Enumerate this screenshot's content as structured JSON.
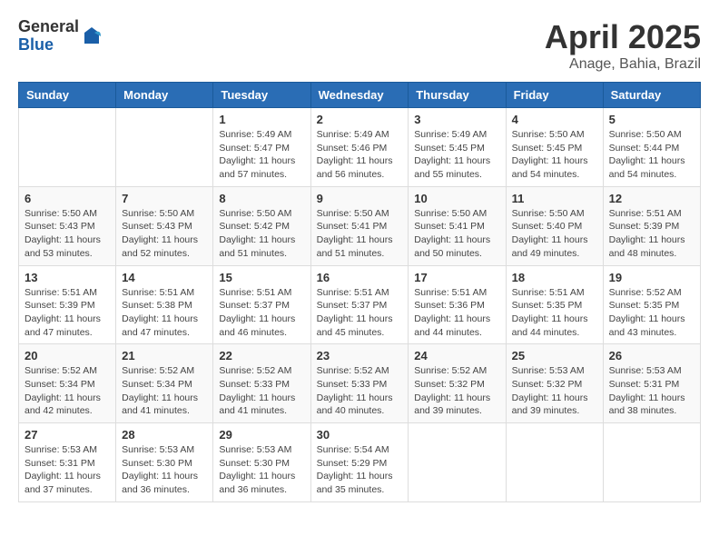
{
  "logo": {
    "general": "General",
    "blue": "Blue"
  },
  "title": "April 2025",
  "location": "Anage, Bahia, Brazil",
  "weekdays": [
    "Sunday",
    "Monday",
    "Tuesday",
    "Wednesday",
    "Thursday",
    "Friday",
    "Saturday"
  ],
  "weeks": [
    [
      {
        "day": "",
        "sunrise": "",
        "sunset": "",
        "daylight": ""
      },
      {
        "day": "",
        "sunrise": "",
        "sunset": "",
        "daylight": ""
      },
      {
        "day": "1",
        "sunrise": "Sunrise: 5:49 AM",
        "sunset": "Sunset: 5:47 PM",
        "daylight": "Daylight: 11 hours and 57 minutes."
      },
      {
        "day": "2",
        "sunrise": "Sunrise: 5:49 AM",
        "sunset": "Sunset: 5:46 PM",
        "daylight": "Daylight: 11 hours and 56 minutes."
      },
      {
        "day": "3",
        "sunrise": "Sunrise: 5:49 AM",
        "sunset": "Sunset: 5:45 PM",
        "daylight": "Daylight: 11 hours and 55 minutes."
      },
      {
        "day": "4",
        "sunrise": "Sunrise: 5:50 AM",
        "sunset": "Sunset: 5:45 PM",
        "daylight": "Daylight: 11 hours and 54 minutes."
      },
      {
        "day": "5",
        "sunrise": "Sunrise: 5:50 AM",
        "sunset": "Sunset: 5:44 PM",
        "daylight": "Daylight: 11 hours and 54 minutes."
      }
    ],
    [
      {
        "day": "6",
        "sunrise": "Sunrise: 5:50 AM",
        "sunset": "Sunset: 5:43 PM",
        "daylight": "Daylight: 11 hours and 53 minutes."
      },
      {
        "day": "7",
        "sunrise": "Sunrise: 5:50 AM",
        "sunset": "Sunset: 5:43 PM",
        "daylight": "Daylight: 11 hours and 52 minutes."
      },
      {
        "day": "8",
        "sunrise": "Sunrise: 5:50 AM",
        "sunset": "Sunset: 5:42 PM",
        "daylight": "Daylight: 11 hours and 51 minutes."
      },
      {
        "day": "9",
        "sunrise": "Sunrise: 5:50 AM",
        "sunset": "Sunset: 5:41 PM",
        "daylight": "Daylight: 11 hours and 51 minutes."
      },
      {
        "day": "10",
        "sunrise": "Sunrise: 5:50 AM",
        "sunset": "Sunset: 5:41 PM",
        "daylight": "Daylight: 11 hours and 50 minutes."
      },
      {
        "day": "11",
        "sunrise": "Sunrise: 5:50 AM",
        "sunset": "Sunset: 5:40 PM",
        "daylight": "Daylight: 11 hours and 49 minutes."
      },
      {
        "day": "12",
        "sunrise": "Sunrise: 5:51 AM",
        "sunset": "Sunset: 5:39 PM",
        "daylight": "Daylight: 11 hours and 48 minutes."
      }
    ],
    [
      {
        "day": "13",
        "sunrise": "Sunrise: 5:51 AM",
        "sunset": "Sunset: 5:39 PM",
        "daylight": "Daylight: 11 hours and 47 minutes."
      },
      {
        "day": "14",
        "sunrise": "Sunrise: 5:51 AM",
        "sunset": "Sunset: 5:38 PM",
        "daylight": "Daylight: 11 hours and 47 minutes."
      },
      {
        "day": "15",
        "sunrise": "Sunrise: 5:51 AM",
        "sunset": "Sunset: 5:37 PM",
        "daylight": "Daylight: 11 hours and 46 minutes."
      },
      {
        "day": "16",
        "sunrise": "Sunrise: 5:51 AM",
        "sunset": "Sunset: 5:37 PM",
        "daylight": "Daylight: 11 hours and 45 minutes."
      },
      {
        "day": "17",
        "sunrise": "Sunrise: 5:51 AM",
        "sunset": "Sunset: 5:36 PM",
        "daylight": "Daylight: 11 hours and 44 minutes."
      },
      {
        "day": "18",
        "sunrise": "Sunrise: 5:51 AM",
        "sunset": "Sunset: 5:35 PM",
        "daylight": "Daylight: 11 hours and 44 minutes."
      },
      {
        "day": "19",
        "sunrise": "Sunrise: 5:52 AM",
        "sunset": "Sunset: 5:35 PM",
        "daylight": "Daylight: 11 hours and 43 minutes."
      }
    ],
    [
      {
        "day": "20",
        "sunrise": "Sunrise: 5:52 AM",
        "sunset": "Sunset: 5:34 PM",
        "daylight": "Daylight: 11 hours and 42 minutes."
      },
      {
        "day": "21",
        "sunrise": "Sunrise: 5:52 AM",
        "sunset": "Sunset: 5:34 PM",
        "daylight": "Daylight: 11 hours and 41 minutes."
      },
      {
        "day": "22",
        "sunrise": "Sunrise: 5:52 AM",
        "sunset": "Sunset: 5:33 PM",
        "daylight": "Daylight: 11 hours and 41 minutes."
      },
      {
        "day": "23",
        "sunrise": "Sunrise: 5:52 AM",
        "sunset": "Sunset: 5:33 PM",
        "daylight": "Daylight: 11 hours and 40 minutes."
      },
      {
        "day": "24",
        "sunrise": "Sunrise: 5:52 AM",
        "sunset": "Sunset: 5:32 PM",
        "daylight": "Daylight: 11 hours and 39 minutes."
      },
      {
        "day": "25",
        "sunrise": "Sunrise: 5:53 AM",
        "sunset": "Sunset: 5:32 PM",
        "daylight": "Daylight: 11 hours and 39 minutes."
      },
      {
        "day": "26",
        "sunrise": "Sunrise: 5:53 AM",
        "sunset": "Sunset: 5:31 PM",
        "daylight": "Daylight: 11 hours and 38 minutes."
      }
    ],
    [
      {
        "day": "27",
        "sunrise": "Sunrise: 5:53 AM",
        "sunset": "Sunset: 5:31 PM",
        "daylight": "Daylight: 11 hours and 37 minutes."
      },
      {
        "day": "28",
        "sunrise": "Sunrise: 5:53 AM",
        "sunset": "Sunset: 5:30 PM",
        "daylight": "Daylight: 11 hours and 36 minutes."
      },
      {
        "day": "29",
        "sunrise": "Sunrise: 5:53 AM",
        "sunset": "Sunset: 5:30 PM",
        "daylight": "Daylight: 11 hours and 36 minutes."
      },
      {
        "day": "30",
        "sunrise": "Sunrise: 5:54 AM",
        "sunset": "Sunset: 5:29 PM",
        "daylight": "Daylight: 11 hours and 35 minutes."
      },
      {
        "day": "",
        "sunrise": "",
        "sunset": "",
        "daylight": ""
      },
      {
        "day": "",
        "sunrise": "",
        "sunset": "",
        "daylight": ""
      },
      {
        "day": "",
        "sunrise": "",
        "sunset": "",
        "daylight": ""
      }
    ]
  ]
}
